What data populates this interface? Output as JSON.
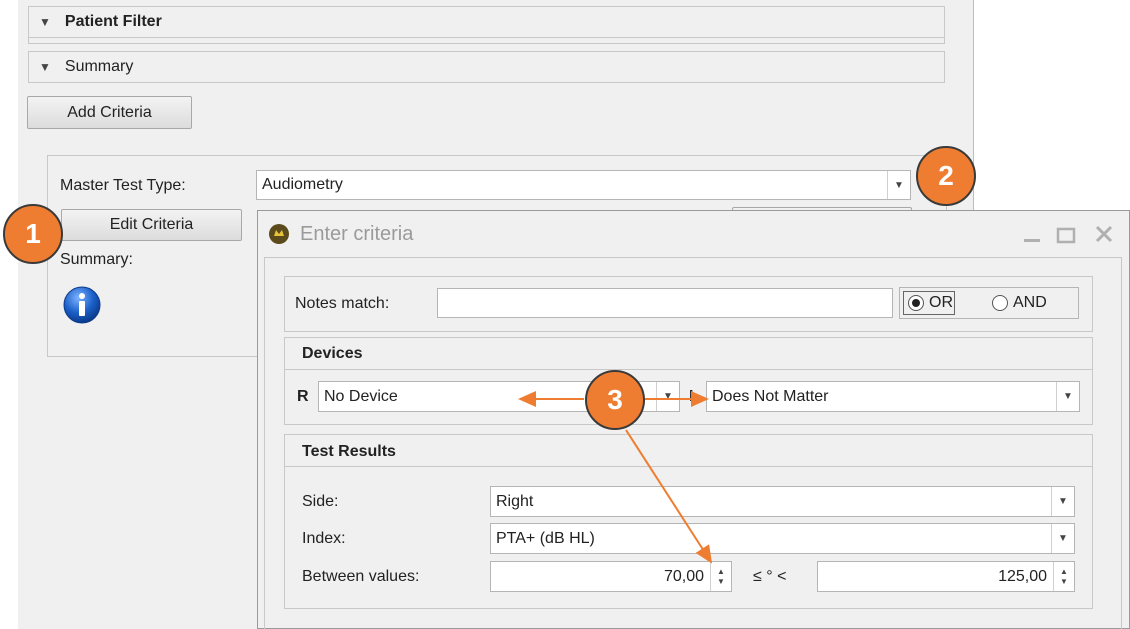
{
  "patient_filter": {
    "label": "Patient Filter"
  },
  "summary_group": {
    "label": "Summary"
  },
  "add_criteria": {
    "label": "Add Criteria"
  },
  "master": {
    "label": "Master Test Type:",
    "value": "Audiometry",
    "edit_label": "Edit Criteria",
    "summary_label": "Summary:"
  },
  "callouts": [
    "1",
    "2",
    "3"
  ],
  "dialog": {
    "title": "Enter criteria",
    "notes": {
      "label": "Notes match:",
      "value": "",
      "or_label": "OR",
      "and_label": "AND",
      "selected": "OR"
    },
    "devices": {
      "title": "Devices",
      "right_label": "R",
      "right_value": "No Device",
      "left_label": "L",
      "left_value": "Does Not Matter"
    },
    "test_results": {
      "title": "Test Results",
      "side_label": "Side:",
      "side_value": "Right",
      "index_label": "Index:",
      "index_value": "PTA+ (dB HL)",
      "between_label": "Between values:",
      "min_value": "70,00",
      "operator": "≤ ° <",
      "max_value": "125,00"
    }
  },
  "colors": {
    "accent": "#ee7d31",
    "info": "#1a5fc8"
  },
  "icons": [
    "collapse-triangle-icon",
    "info-icon",
    "dialog-app-icon",
    "minimize-icon",
    "maximize-icon",
    "close-icon",
    "chevron-down-icon",
    "spin-arrows-icon"
  ]
}
